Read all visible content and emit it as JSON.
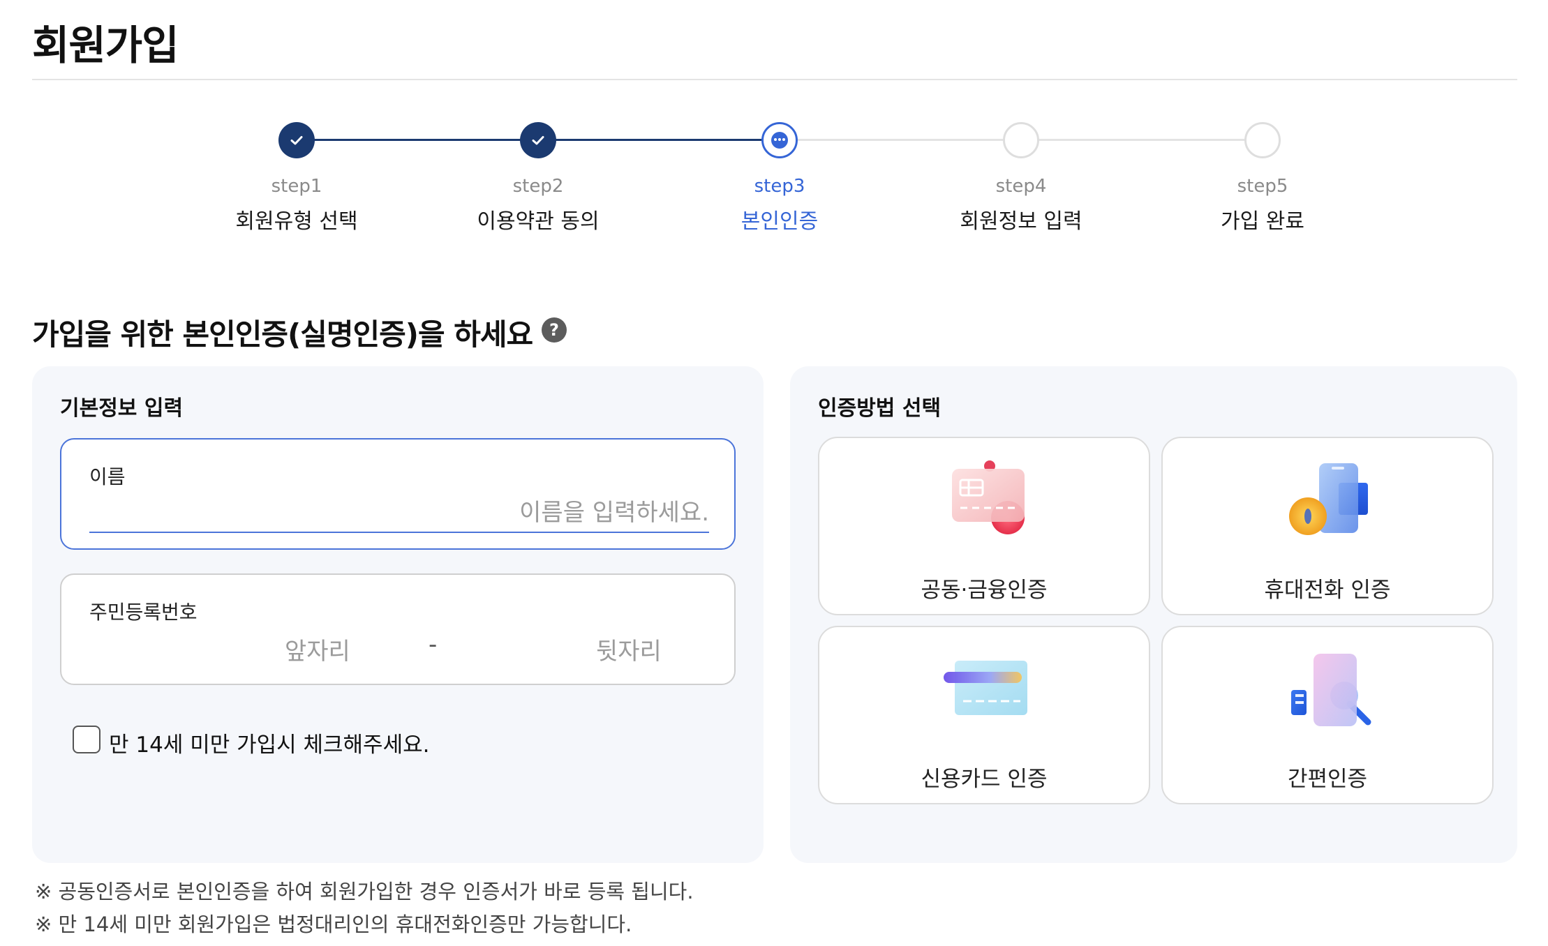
{
  "page": {
    "title": "회원가입"
  },
  "stepper": {
    "steps": [
      {
        "num": "step1",
        "label": "회원유형 선택",
        "state": "done"
      },
      {
        "num": "step2",
        "label": "이용약관 동의",
        "state": "done"
      },
      {
        "num": "step3",
        "label": "본인인증",
        "state": "current"
      },
      {
        "num": "step4",
        "label": "회원정보 입력",
        "state": "todo"
      },
      {
        "num": "step5",
        "label": "가입 완료",
        "state": "todo"
      }
    ]
  },
  "section": {
    "heading": "가입을 위한 본인인증(실명인증)을 하세요",
    "help": "?"
  },
  "basic_info": {
    "title": "기본정보 입력",
    "name_label": "이름",
    "name_value": "",
    "name_placeholder": "이름을 입력하세요.",
    "rrn_label": "주민등록번호",
    "rrn_front": "앞자리",
    "rrn_dash": "-",
    "rrn_back": "뒷자리",
    "under14_label": "만 14세 미만 가입시 체크해주세요.",
    "under14_checked": false
  },
  "auth": {
    "title": "인증방법 선택",
    "methods": [
      {
        "label": "공동·금융인증",
        "icon": "certificate-icon"
      },
      {
        "label": "휴대전화 인증",
        "icon": "mobile-phone-icon"
      },
      {
        "label": "신용카드 인증",
        "icon": "credit-card-icon"
      },
      {
        "label": "간편인증",
        "icon": "simple-auth-icon"
      }
    ]
  },
  "notes": [
    "※ 공동인증서로 본인인증을 하여 회원가입한 경우 인증서가 바로 등록 됩니다.",
    "※ 만 14세 미만 회원가입은 법정대리인의 휴대전화인증만 가능합니다."
  ],
  "colors": {
    "primary": "#1b3a70",
    "accent": "#3565d6",
    "panel_bg": "#f5f7fb"
  }
}
